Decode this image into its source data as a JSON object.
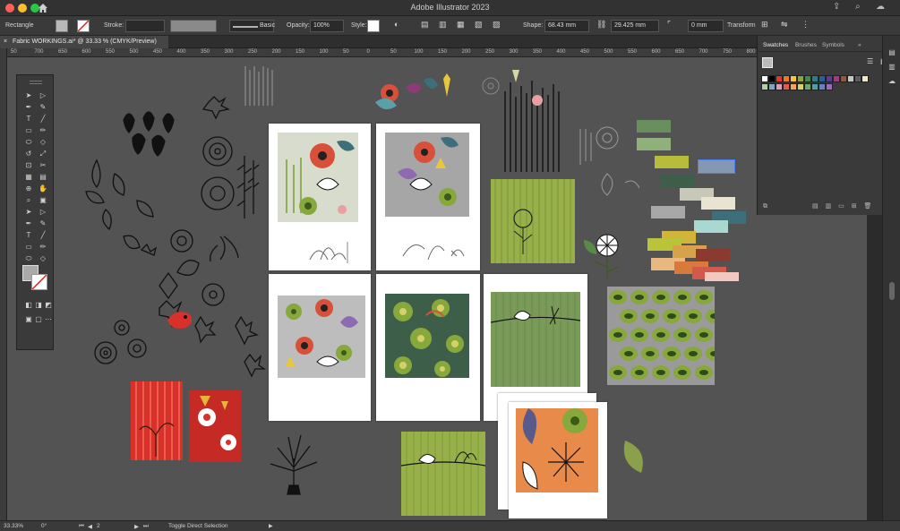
{
  "window": {
    "title": "Adobe Illustrator 2023",
    "right_icons": [
      "share-icon",
      "search-icon",
      "cloud-icon"
    ]
  },
  "control_bar": {
    "object_type": "Rectangle",
    "stroke_label": "Stroke:",
    "brush_label": "Basic",
    "opacity_label": "Opacity:",
    "opacity_value": "100%",
    "style_label": "Style:",
    "shape_label": "Shape:",
    "width_value": "68.43 mm",
    "height_value": "29.425 mm",
    "corner_value": "0 mm",
    "transform_label": "Transform"
  },
  "document_tab": {
    "label": "Fabric WORKINGS.ai* @ 33.33 % (CMYK/Preview)",
    "close_glyph": "×"
  },
  "ruler": {
    "h_labels": [
      "50",
      "700",
      "650",
      "600",
      "550",
      "500",
      "450",
      "400",
      "350",
      "300",
      "250",
      "200",
      "150",
      "100",
      "50",
      "0",
      "50",
      "100",
      "150",
      "200",
      "250",
      "300",
      "350",
      "400",
      "450",
      "500",
      "550",
      "600",
      "650",
      "700",
      "750",
      "800",
      "850",
      "900",
      "950",
      "1000",
      "1050"
    ]
  },
  "swatches_panel": {
    "tabs": [
      "Swatches",
      "Brushes",
      "Symbols"
    ],
    "active_tab": "Swatches",
    "swatch_colors": [
      "#ffffff",
      "#000000",
      "#d93c2e",
      "#e87b2a",
      "#f2c935",
      "#87a83a",
      "#3d8a4a",
      "#2d7d86",
      "#2a5d9e",
      "#5a3d8e",
      "#a03c7e",
      "#8a5a3a",
      "#c8c8c8",
      "#5e5e5e",
      "#f0e6c8",
      "#b0d0a0",
      "#7fa6c9",
      "#d8a0b8",
      "#e35a4a",
      "#f5a35a",
      "#d6d06a",
      "#6aa86a",
      "#4aa0a8",
      "#6a7fc0",
      "#9a6ac0"
    ]
  },
  "status_bar": {
    "zoom": "33.33%",
    "rotation": "0°",
    "artboard_number": "2",
    "tool_hint": "Toggle Direct Selection"
  },
  "palette_chips": [
    "#6a8f5e",
    "#8fb07a",
    "#b7bc3a",
    "#8497b3",
    "#3d5f4a",
    "#c7c8b8",
    "#e9e4d2",
    "#a8a8a8",
    "#3c6f7a",
    "#a9d8d3",
    "#d2b43a",
    "#b9c43a",
    "#d8a24a",
    "#8a3a2e",
    "#e9b880",
    "#d97a3a",
    "#d35a4a",
    "#f2c8c0"
  ]
}
